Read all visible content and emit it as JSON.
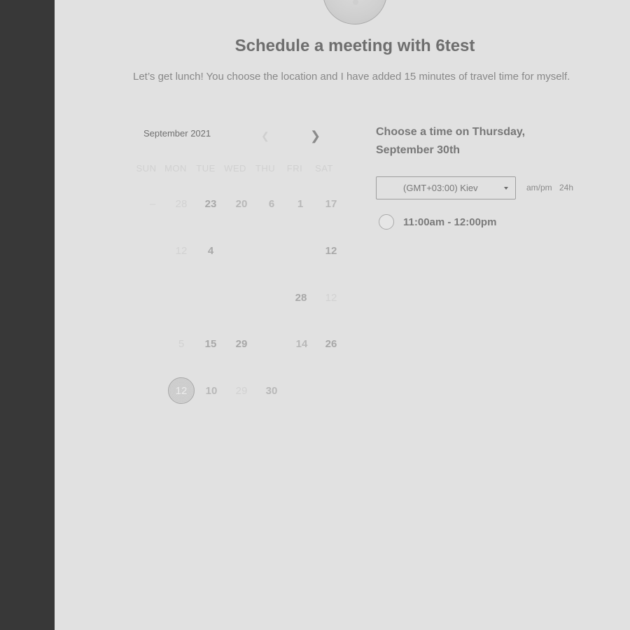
{
  "header": {
    "title": "Schedule a meeting with 6test",
    "subtitle": "Let’s get lunch! You choose the location and I have added 15 minutes of travel time for myself."
  },
  "calendar": {
    "month_label": "September 2021",
    "prev_icon": "chevron-left-icon",
    "next_icon": "chevron-right-icon",
    "weekdays": [
      "SUN",
      "MON",
      "TUE",
      "WED",
      "THU",
      "FRI",
      "SAT"
    ],
    "rows": [
      [
        "–",
        "28",
        "23",
        "20",
        "6",
        "1",
        "17"
      ],
      [
        "12",
        "4",
        "12"
      ],
      [
        "28",
        "12"
      ],
      [
        "5",
        "15",
        "29",
        "14",
        "26"
      ],
      [
        "12",
        "10",
        "29",
        "30"
      ]
    ],
    "selected_day": "12"
  },
  "booking": {
    "choose_title": "Choose a time on Thursday, September 30th",
    "timezone": "(GMT+03:00) Kiev",
    "format_ampm": "am/pm",
    "format_24h": "24h",
    "slots": [
      {
        "label": "11:00am - 12:00pm"
      }
    ]
  },
  "colors": {
    "sidebar": "#383838",
    "background": "#e1e1e1"
  }
}
